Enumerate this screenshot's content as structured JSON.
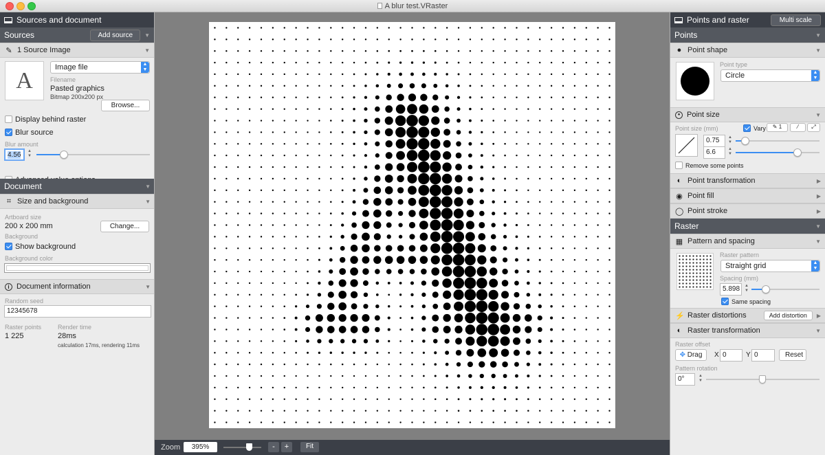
{
  "window": {
    "title": "A blur test.VRaster"
  },
  "left_panel": {
    "header": "Sources and document",
    "sources": {
      "title": "Sources",
      "add_button": "Add source"
    },
    "source_image": {
      "title": "1 Source Image",
      "thumbnail_letter": "A",
      "type": "Image file",
      "filename_label": "Filename",
      "filename": "Pasted graphics",
      "bitmap_info": "Bitmap 200x200 px",
      "browse": "Browse...",
      "display_behind": "Display behind raster",
      "blur_source": "Blur source",
      "blur_amount_label": "Blur amount",
      "blur_amount": "4.56",
      "advanced": "Advanced value options"
    },
    "document": {
      "title": "Document",
      "size_bg_title": "Size and background",
      "artboard_size_label": "Artboard size",
      "artboard_size": "200 x 200 mm",
      "change_button": "Change...",
      "background_label": "Background",
      "show_background": "Show background",
      "background_color_label": "Background color"
    },
    "info": {
      "title": "Document information",
      "random_seed_label": "Random seed",
      "random_seed": "12345678",
      "raster_points_label": "Raster points",
      "raster_points": "1 225",
      "render_time_label": "Render time",
      "render_time": "28ms",
      "render_detail": "calculation 17ms, rendering 11ms"
    }
  },
  "right_panel": {
    "header": "Points and raster",
    "multi_scale": "Multi scale",
    "points": {
      "title": "Points",
      "point_shape": "Point shape",
      "point_type_label": "Point type",
      "point_type": "Circle",
      "point_size": "Point size",
      "point_size_label": "Point size (mm)",
      "vary": "Vary",
      "vary_count": "1",
      "size_min": "0.75",
      "size_max": "6.6",
      "remove_some": "Remove some points",
      "point_transformation": "Point transformation",
      "point_fill": "Point fill",
      "point_stroke": "Point stroke"
    },
    "raster": {
      "title": "Raster",
      "pattern_spacing": "Pattern and spacing",
      "raster_pattern_label": "Raster pattern",
      "raster_pattern": "Straight grid",
      "spacing_label": "Spacing (mm)",
      "spacing": "5.898",
      "same_spacing": "Same spacing",
      "distortions": "Raster distortions",
      "add_distortion": "Add distortion",
      "transformation": "Raster transformation",
      "offset_label": "Raster offset",
      "drag": "Drag",
      "x_label": "X",
      "x_val": "0",
      "y_label": "Y",
      "y_val": "0",
      "reset": "Reset",
      "rotation_label": "Pattern rotation",
      "rotation": "0°"
    }
  },
  "status": {
    "zoom_label": "Zoom",
    "zoom": "395%",
    "minus": "-",
    "plus": "+",
    "fit": "Fit"
  },
  "colors": {
    "accent": "#3b8ef2",
    "panel_dark": "#3b3f47",
    "section": "#54585f"
  }
}
